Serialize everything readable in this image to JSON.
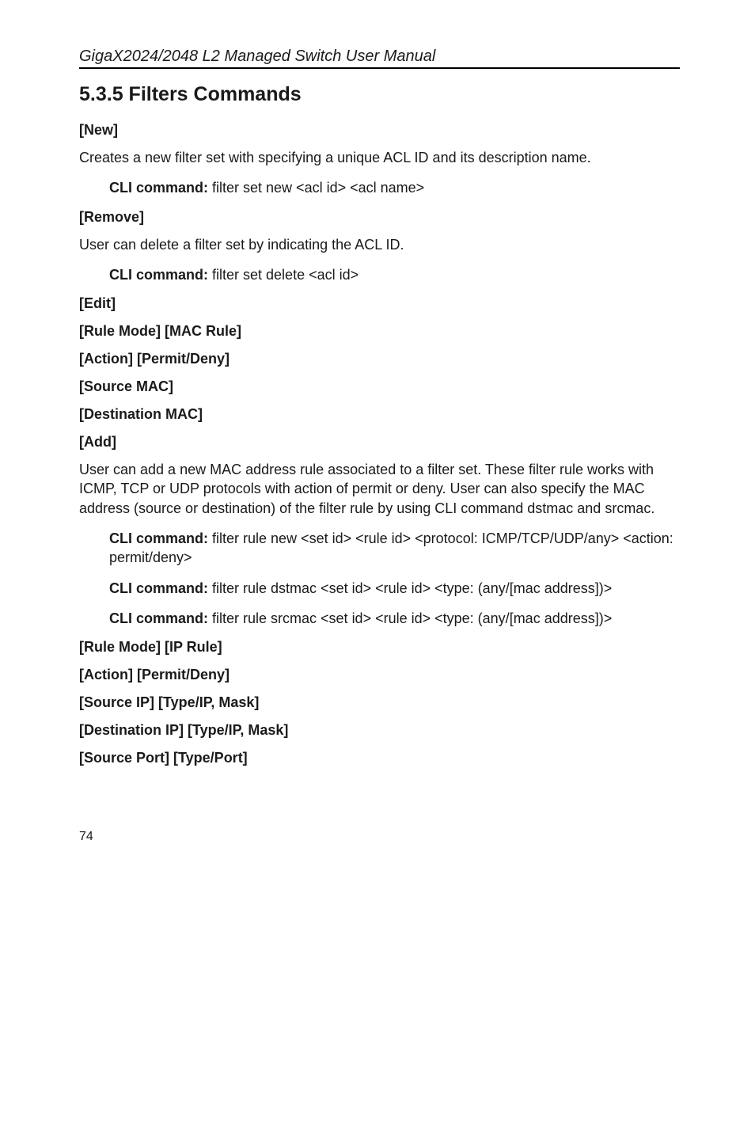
{
  "header": "GigaX2024/2048 L2 Managed Switch User Manual",
  "sectionHeading": "5.3.5 Filters Commands",
  "cliLabel": "CLI command:",
  "blocks": {
    "new": {
      "title": "[New]",
      "desc": "Creates a new filter set with specifying a unique ACL ID and its description name.",
      "cli": " filter set new <acl id> <acl name>"
    },
    "remove": {
      "title": "[Remove]",
      "desc": "User can delete a filter set by indicating the ACL ID.",
      "cli": " filter set delete <acl id>"
    },
    "edit": "[Edit]",
    "ruleModeMac": "[Rule Mode] [MAC Rule]",
    "actionPermit1": "[Action] [Permit/Deny]",
    "sourceMac": "[Source MAC]",
    "destMac": "[Destination MAC]",
    "add": {
      "title": "[Add]",
      "desc": "User can add a new MAC address rule associated to a filter set. These filter rule works with ICMP, TCP or UDP protocols with action of permit or deny. User can also specify the MAC address (source or destination) of the filter rule by using CLI command dstmac and srcmac.",
      "cli1": " filter rule new <set id> <rule id> <protocol: ICMP/TCP/UDP/any> <action: permit/deny>",
      "cli2": " filter rule dstmac <set id> <rule id> <type: (any/[mac address])>",
      "cli3": " filter rule srcmac <set id> <rule id> <type: (any/[mac address])>"
    },
    "ruleModeIp": "[Rule Mode] [IP Rule]",
    "actionPermit2": "[Action] [Permit/Deny]",
    "sourceIp": "[Source IP] [Type/IP, Mask]",
    "destIp": "[Destination IP] [Type/IP, Mask]",
    "sourcePort": "[Source Port] [Type/Port]"
  },
  "pageNumber": "74"
}
